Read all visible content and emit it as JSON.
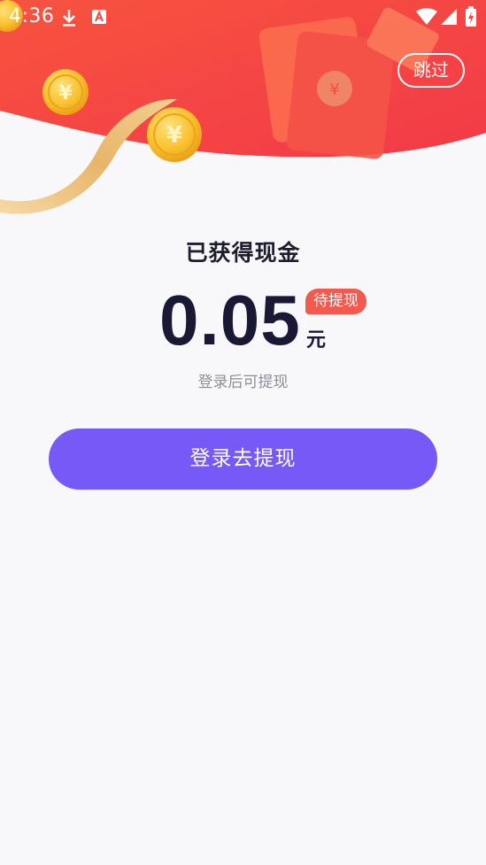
{
  "status_bar": {
    "time": "4:36",
    "icons": [
      "download-icon",
      "notification-a-icon",
      "wifi-icon",
      "signal-icon",
      "battery-charging-icon"
    ]
  },
  "header": {
    "skip_label": "跳过",
    "coin_symbol": "¥",
    "colors": {
      "banner_red": "#f5473d",
      "coin_gold": "#f7c531"
    }
  },
  "reward": {
    "title": "已获得现金",
    "amount": "0.05",
    "status_badge": "待提现",
    "unit": "元",
    "hint": "登录后可提现"
  },
  "actions": {
    "login_withdraw_label": "登录去提现",
    "button_color": "#7659f7"
  }
}
